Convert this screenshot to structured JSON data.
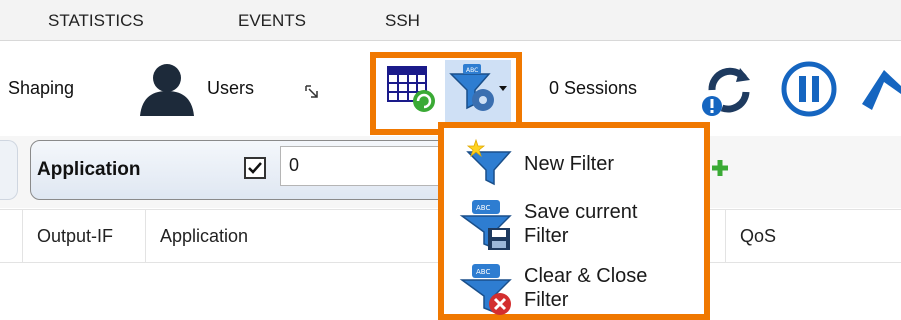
{
  "tabs": [
    "STATISTICS",
    "EVENTS",
    "SSH"
  ],
  "ribbon": {
    "shaping_label": "Shaping",
    "users_label": "Users",
    "sessions_label": "0 Sessions"
  },
  "filter": {
    "application_label": "Application",
    "checkbox_checked": true,
    "value": "0"
  },
  "columns": [
    "Output-IF",
    "Application",
    "QoS"
  ],
  "menu": {
    "new_filter": "New Filter",
    "save_line1": "Save current",
    "save_line2": "Filter",
    "clear_line1": "Clear & Close",
    "clear_line2": "Filter"
  },
  "colors": {
    "highlight": "#f07800",
    "accent_blue": "#1565c0",
    "plus_green": "#3aaa35"
  }
}
